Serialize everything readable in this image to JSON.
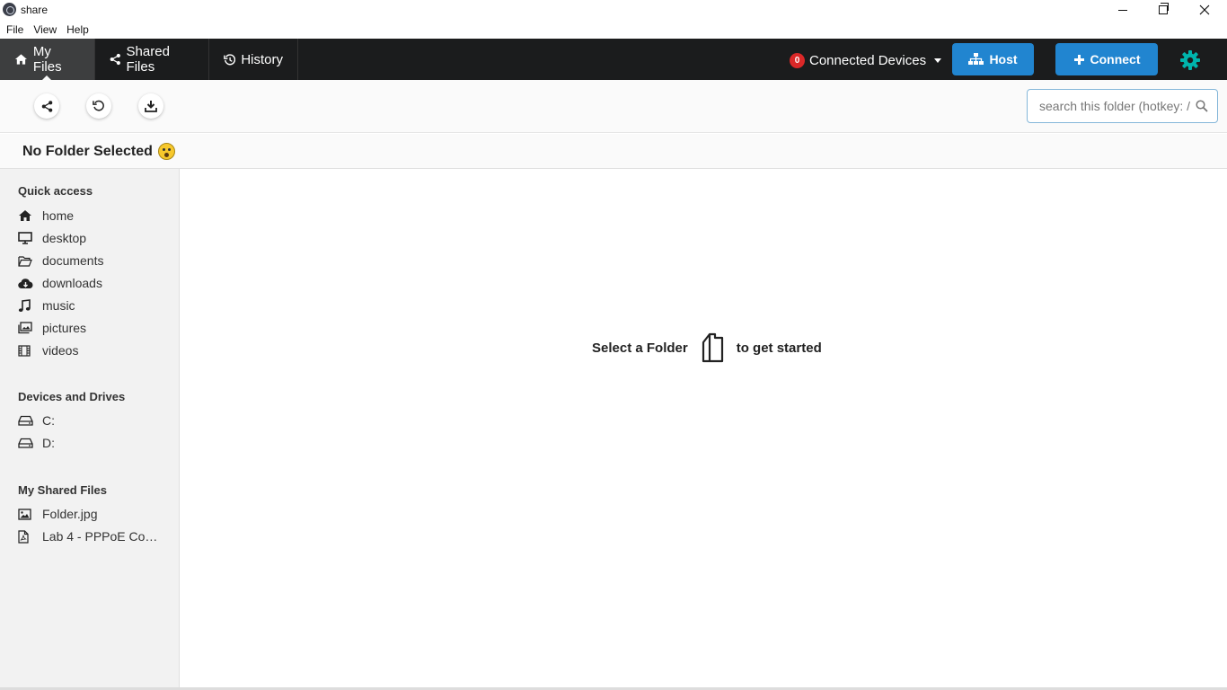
{
  "window": {
    "title": "share"
  },
  "menu": [
    "File",
    "View",
    "Help"
  ],
  "nav": {
    "tabs": [
      {
        "label": "My Files",
        "icon": "home-icon",
        "active": true
      },
      {
        "label": "Shared Files",
        "icon": "share-icon",
        "active": false
      },
      {
        "label": "History",
        "icon": "history-icon",
        "active": false
      }
    ],
    "devices_count": "0",
    "devices_label": "Connected Devices",
    "host_label": "Host",
    "connect_label": "Connect"
  },
  "toolbar": {
    "search_placeholder": "search this folder (hotkey: /)"
  },
  "folder": {
    "title": "No Folder Selected"
  },
  "sidebar": {
    "quick_access_title": "Quick access",
    "quick_access": [
      {
        "label": "home",
        "icon": "home-icon"
      },
      {
        "label": "desktop",
        "icon": "desktop-icon"
      },
      {
        "label": "documents",
        "icon": "folder-open-icon"
      },
      {
        "label": "downloads",
        "icon": "cloud-download-icon"
      },
      {
        "label": "music",
        "icon": "music-icon"
      },
      {
        "label": "pictures",
        "icon": "images-icon"
      },
      {
        "label": "videos",
        "icon": "film-icon"
      }
    ],
    "drives_title": "Devices and Drives",
    "drives": [
      {
        "label": "C:",
        "icon": "drive-icon"
      },
      {
        "label": "D:",
        "icon": "drive-icon"
      }
    ],
    "shared_title": "My Shared Files",
    "shared": [
      {
        "label": "Folder.jpg",
        "icon": "image-file-icon"
      },
      {
        "label": "Lab 4 - PPPoE Con...",
        "icon": "pdf-file-icon"
      }
    ]
  },
  "main": {
    "empty_before": "Select a Folder",
    "empty_after": "to get started"
  },
  "colors": {
    "navbar": "#1b1c1d",
    "primary": "#2185d0",
    "badge": "#db2828",
    "gear": "#00b5ad"
  }
}
